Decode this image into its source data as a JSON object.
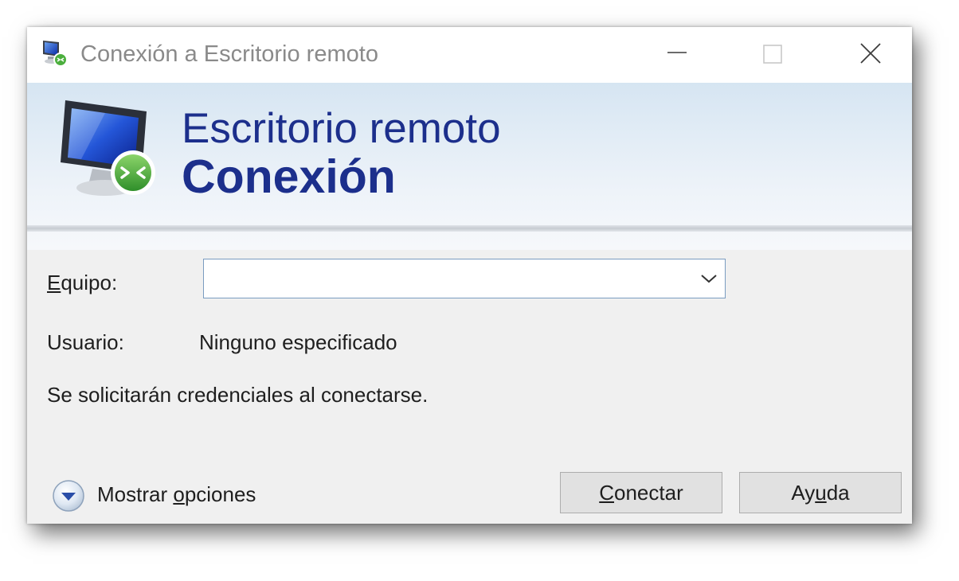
{
  "window": {
    "title": "Conexión a Escritorio remoto"
  },
  "banner": {
    "line1": "Escritorio remoto",
    "line2": "Conexión"
  },
  "form": {
    "computer": {
      "label_accel": "E",
      "label_rest": "quipo:",
      "value": "",
      "placeholder": ""
    },
    "user": {
      "label": "Usuario:",
      "value": "Ninguno especificado"
    },
    "info": "Se solicitarán credenciales al conectarse."
  },
  "options": {
    "label_pre": "Mostrar ",
    "label_accel": "o",
    "label_post": "pciones"
  },
  "buttons": {
    "connect": {
      "accel": "C",
      "rest": "onectar"
    },
    "help": {
      "pre": "Ay",
      "accel": "u",
      "post": "da"
    }
  },
  "icons": {
    "app": "remote-desktop-icon",
    "minimize": "minimize-icon",
    "maximize": "maximize-icon",
    "close": "close-icon",
    "combo": "chevron-down-icon",
    "options": "chevron-down-circle-icon"
  },
  "colors": {
    "accent": "#1c2f8c",
    "title_text": "#8a8a8a",
    "dialog_bg": "#f0f0f0",
    "combo_border": "#7a9cc0"
  }
}
